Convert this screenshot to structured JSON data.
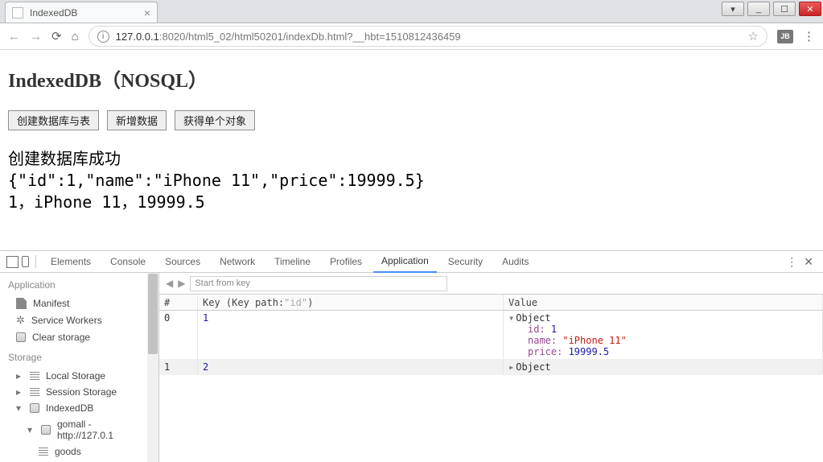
{
  "window": {
    "title": "IndexedDB"
  },
  "address": {
    "host": "127.0.0.1",
    "port": ":8020",
    "path": "/html5_02/html50201/indexDb.html?__hbt=1510812436459"
  },
  "ext_badge": "JB",
  "page": {
    "heading": "IndexedDB（NOSQL）",
    "buttons": {
      "create": "创建数据库与表",
      "add": "新增数据",
      "get": "获得单个对象"
    },
    "output": {
      "l1": "创建数据库成功",
      "l2": "{\"id\":1,\"name\":\"iPhone 11\",\"price\":19999.5}",
      "l3": "1，iPhone 11，19999.5"
    }
  },
  "devtools": {
    "tabs": {
      "elements": "Elements",
      "console": "Console",
      "sources": "Sources",
      "network": "Network",
      "timeline": "Timeline",
      "profiles": "Profiles",
      "application": "Application",
      "security": "Security",
      "audits": "Audits"
    },
    "sidebar": {
      "application_h": "Application",
      "manifest": "Manifest",
      "sw": "Service Workers",
      "clear": "Clear storage",
      "storage_h": "Storage",
      "local": "Local Storage",
      "session": "Session Storage",
      "idb": "IndexedDB",
      "dbline": "gomall - http://127.0.1",
      "store": "goods"
    },
    "toolbar": {
      "filter_ph": "Start from key"
    },
    "grid": {
      "head": {
        "idx": "#",
        "key": "Key (Key path: ",
        "keypath": "\"id\"",
        "key_close": ")",
        "val": "Value"
      },
      "rows": [
        {
          "idx": "0",
          "key": "1",
          "expanded": true,
          "obj": {
            "id": "1",
            "name": "\"iPhone 11\"",
            "price": "19999.5"
          }
        },
        {
          "idx": "1",
          "key": "2",
          "expanded": false
        }
      ],
      "objlabel": "Object",
      "klabels": {
        "id": "id: ",
        "name": "name: ",
        "price": "price: "
      }
    }
  }
}
